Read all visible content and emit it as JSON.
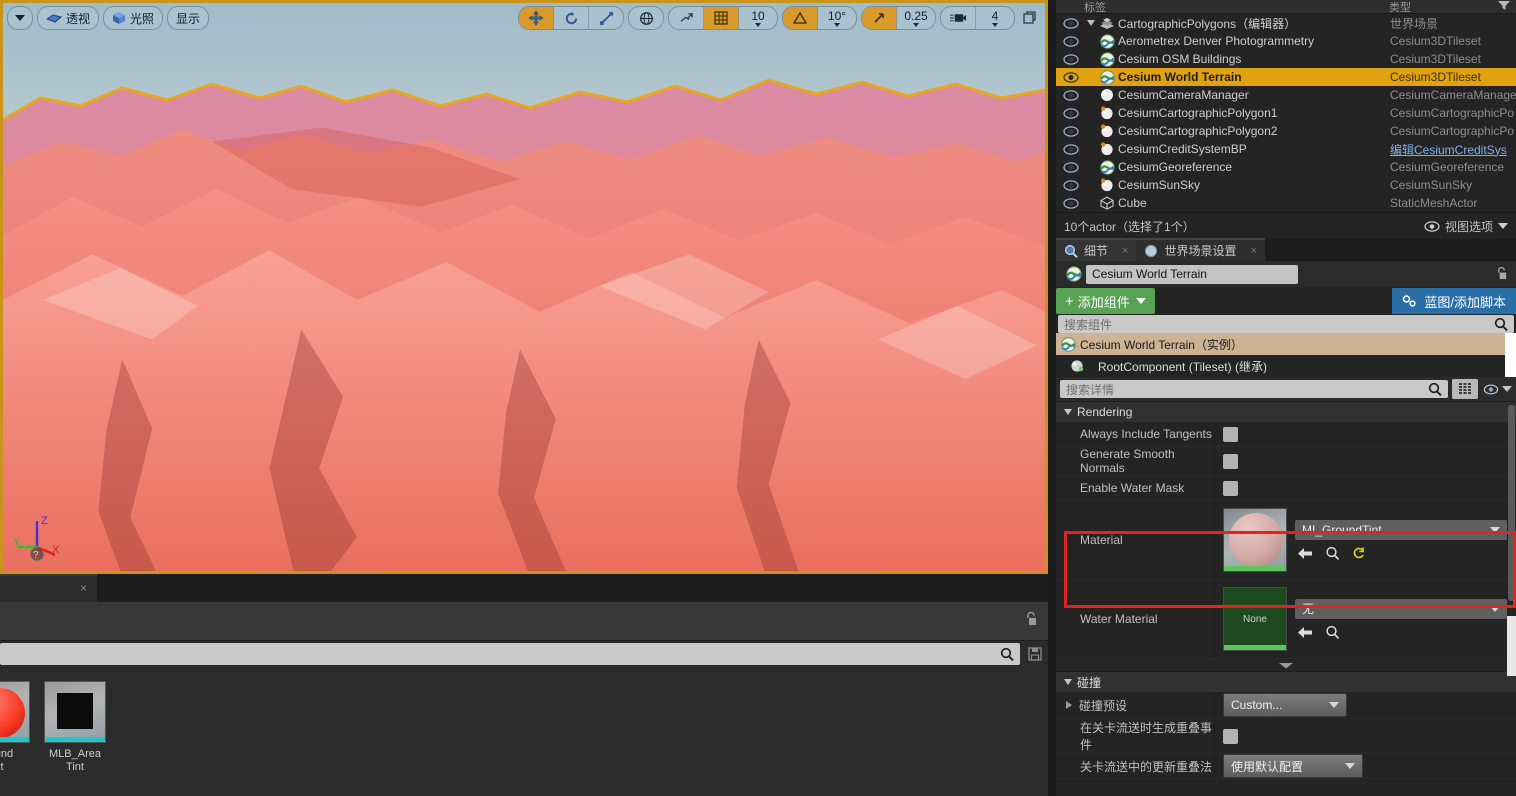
{
  "viewport": {
    "toolbar_left": [
      {
        "name": "viewport-options",
        "label": "",
        "icon": "chevron-down-icon"
      },
      {
        "name": "perspective",
        "label": "透视",
        "icon": "camera-perspective-icon"
      },
      {
        "name": "lighting",
        "label": "光照",
        "icon": "cube-lit-icon"
      },
      {
        "name": "show",
        "label": "显示",
        "icon": "none"
      }
    ],
    "toolbar_right": {
      "translate_icon": "move-gizmo-icon",
      "rotate_icon": "rotate-gizmo-icon",
      "scale_icon": "scale-gizmo-icon",
      "coord_icon": "world-globe-icon",
      "surface_snap_icon": "surface-snap-icon",
      "grid_snap_icon": "grid-snap-icon",
      "grid_snap_value": "10",
      "angle_snap_icon": "angle-snap-icon",
      "angle_snap_value": "10°",
      "scale_snap_icon": "scale-snap-icon",
      "scale_snap_value": "0.25",
      "camera_speed_icon": "camera-speed-icon",
      "camera_speed_value": "4",
      "maximize_icon": "maximize-viewport-icon"
    },
    "gizmo": {
      "x": "X",
      "y": "Y",
      "z": "Z"
    }
  },
  "content_browser": {
    "search_placeholder": "",
    "assets": [
      {
        "label": "M_GroundTint",
        "thumb": "red-sphere"
      },
      {
        "label": "MLB_Area\nTint",
        "thumb": "black-square"
      }
    ],
    "asset_labels": [
      "round\nnt",
      "MLB_Area\nTint"
    ]
  },
  "outliner": {
    "col_label": "标签",
    "col_type": "类型",
    "rows": [
      {
        "label": "CartographicPolygons（编辑器）",
        "type": "世界场景",
        "icon": "folder-layers-icon",
        "indent": 0,
        "selected": false,
        "expander": true
      },
      {
        "label": "Aerometrex Denver Photogrammetry",
        "type": "Cesium3DTileset",
        "icon": "cesium-tileset-icon",
        "indent": 1,
        "selected": false
      },
      {
        "label": "Cesium OSM Buildings",
        "type": "Cesium3DTileset",
        "icon": "cesium-tileset-icon",
        "indent": 1,
        "selected": false
      },
      {
        "label": "Cesium World Terrain",
        "type": "Cesium3DTileset",
        "icon": "cesium-tileset-icon",
        "indent": 1,
        "selected": true
      },
      {
        "label": "CesiumCameraManager",
        "type": "CesiumCameraManage",
        "icon": "actor-sphere-icon",
        "indent": 1,
        "selected": false
      },
      {
        "label": "CesiumCartographicPolygon1",
        "type": "CesiumCartographicPo",
        "icon": "actor-bp-icon",
        "indent": 1,
        "selected": false
      },
      {
        "label": "CesiumCartographicPolygon2",
        "type": "CesiumCartographicPo",
        "icon": "actor-bp-icon",
        "indent": 1,
        "selected": false
      },
      {
        "label": "CesiumCreditSystemBP",
        "type": "编辑CesiumCreditSys",
        "icon": "actor-bp-icon",
        "indent": 1,
        "selected": false,
        "link": true
      },
      {
        "label": "CesiumGeoreference",
        "type": "CesiumGeoreference",
        "icon": "cesium-tileset-icon",
        "indent": 1,
        "selected": false
      },
      {
        "label": "CesiumSunSky",
        "type": "CesiumSunSky",
        "icon": "actor-bp-icon",
        "indent": 1,
        "selected": false
      },
      {
        "label": "Cube",
        "type": "StaticMeshActor",
        "icon": "static-mesh-icon",
        "indent": 1,
        "selected": false
      }
    ],
    "status": "10个actor（选择了1个）",
    "view_options": "视图选项"
  },
  "details": {
    "tabs": [
      {
        "label": "细节",
        "icon": "details-magnifier-icon",
        "active": true
      },
      {
        "label": "世界场景设置",
        "icon": "world-settings-icon",
        "active": false
      }
    ],
    "actor_name": "Cesium World Terrain",
    "add_component_label": "添加组件",
    "blueprint_label": "蓝图/添加脚本",
    "component_search_placeholder": "搜索组件",
    "components": [
      {
        "label": "Cesium World Terrain（实例）",
        "selected": true,
        "icon": "cesium-tileset-icon"
      },
      {
        "label": "RootComponent (Tileset) (继承)",
        "selected": false,
        "icon": "component-sphere-icon"
      }
    ],
    "details_search_placeholder": "搜索详情",
    "categories": [
      {
        "name": "Rendering",
        "title": "Rendering",
        "properties": [
          {
            "label": "Always Include Tangents",
            "type": "checkbox",
            "checked": false
          },
          {
            "label": "Generate Smooth Normals",
            "type": "checkbox",
            "checked": false
          },
          {
            "label": "Enable Water Mask",
            "type": "checkbox",
            "checked": false
          },
          {
            "label": "Material",
            "type": "asset",
            "value": "MI_GroundTint",
            "thumb": "pink-sphere",
            "highlighted": true,
            "buttons": [
              "back-arrow-icon",
              "browse-magnifier-icon",
              "reset-arrow-icon"
            ]
          },
          {
            "label": "Water Material",
            "type": "asset",
            "value": "无",
            "thumb": "none-green",
            "thumb_text": "None",
            "buttons": [
              "back-arrow-icon",
              "browse-magnifier-icon"
            ]
          }
        ]
      },
      {
        "name": "Collision",
        "title": "碰撞",
        "properties": [
          {
            "label": "碰撞预设",
            "type": "combo",
            "value": "Custom...",
            "expandable": true
          },
          {
            "label": "在关卡流送时生成重叠事件",
            "type": "checkbox",
            "checked": false
          },
          {
            "label": "关卡流送中的更新重叠法",
            "type": "combo",
            "value": "使用默认配置"
          }
        ]
      }
    ]
  },
  "colors": {
    "selection_amber": "#e0a211",
    "component_selected": "#cdb293",
    "highlight_red": "#e52222",
    "green_button": "#57a353",
    "blue_button": "#2a6ea8",
    "viewport_border": "#c8951a",
    "asset_bar_cyan": "#1ec8c8",
    "material_bar_green": "#5ec45e"
  }
}
